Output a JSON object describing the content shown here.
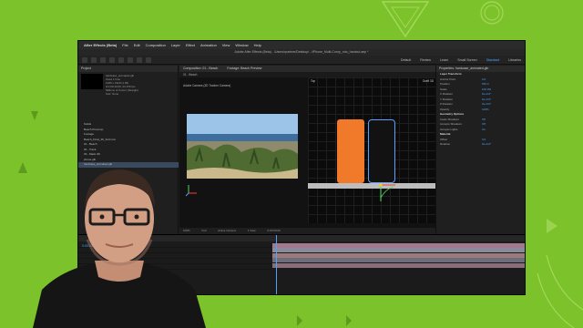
{
  "app": {
    "name": "After Effects (Beta)",
    "menus": [
      "File",
      "Edit",
      "Composition",
      "Layer",
      "Effect",
      "Animation",
      "View",
      "Window",
      "Help"
    ],
    "window_title": "Adobe After Effects (Beta) - /Users/rpartner/Desktop/.../iPhone_Multi-Comp_roto_hardcut.aep *"
  },
  "workspaces": [
    "Default",
    "Review",
    "Learn",
    "Small Screen",
    "Standard",
    "Libraries"
  ],
  "active_workspace": "Standard",
  "project": {
    "title": "Project",
    "info": [
      "hardcase_animated.glb",
      "Used 1 time",
      "1080 x 1920 (1.00)",
      "Δ 0:00:10:00, 23.976 fps",
      "Millions of Colors (Straight)",
      "Sub: None"
    ],
    "items": [
      {
        "name": "Solids",
        "selected": false
      },
      {
        "name": "Beach Precomp",
        "selected": false
      },
      {
        "name": "Footage",
        "selected": false
      },
      {
        "name": "Beach_Final_4K_Full.mov",
        "selected": false
      },
      {
        "name": "01 - Beach",
        "selected": false
      },
      {
        "name": "02 - Track",
        "selected": false
      },
      {
        "name": "03 - Mask 3D",
        "selected": false
      },
      {
        "name": "phone.glb",
        "selected": false
      },
      {
        "name": "hardcase_animated.glb",
        "selected": true
      }
    ]
  },
  "composition": {
    "tabs": [
      "Composition: 01 - Beach",
      "Footage: Beach Preview"
    ],
    "subtab": "01 - Beach",
    "footage_label": "Adobe Camera (3D Tracker Camera)",
    "view_left": "Top",
    "view_right": "Draft 3D",
    "footer": [
      "100%",
      "Full",
      "Active Camera",
      "1 View",
      "0:00:00:00"
    ]
  },
  "properties": {
    "title": "Properties: hardcase_animated.glb",
    "sections": [
      {
        "label": "Layer Transform",
        "header": true
      },
      {
        "label": "Anchor Point",
        "value": "0.0"
      },
      {
        "label": "Position",
        "value": "540.0"
      },
      {
        "label": "Scale",
        "value": "100.0%"
      },
      {
        "label": "X Rotation",
        "value": "0x+0.0°"
      },
      {
        "label": "Y Rotation",
        "value": "0x+0.0°"
      },
      {
        "label": "Z Rotation",
        "value": "0x+0.0°"
      },
      {
        "label": "Opacity",
        "value": "100%"
      },
      {
        "label": "Geometry Options",
        "header": true
      },
      {
        "label": "Casts Shadows",
        "value": "Off"
      },
      {
        "label": "Accepts Shadows",
        "value": "Off"
      },
      {
        "label": "Accepts Lights",
        "value": "On"
      },
      {
        "label": "Material",
        "header": true
      },
      {
        "label": "Offset",
        "value": "0.0"
      },
      {
        "label": "Rotation",
        "value": "0x+0.0°"
      }
    ]
  },
  "timeline": {
    "layers": [
      "hardcase_animated.glb",
      "phone.glb",
      "Camera",
      "Track",
      "Beach"
    ],
    "timecode": "0:00:00:00"
  },
  "colors": {
    "background": "#7cc22a",
    "accent": "#4aa3ff",
    "phone_case": "#f07a2a"
  }
}
